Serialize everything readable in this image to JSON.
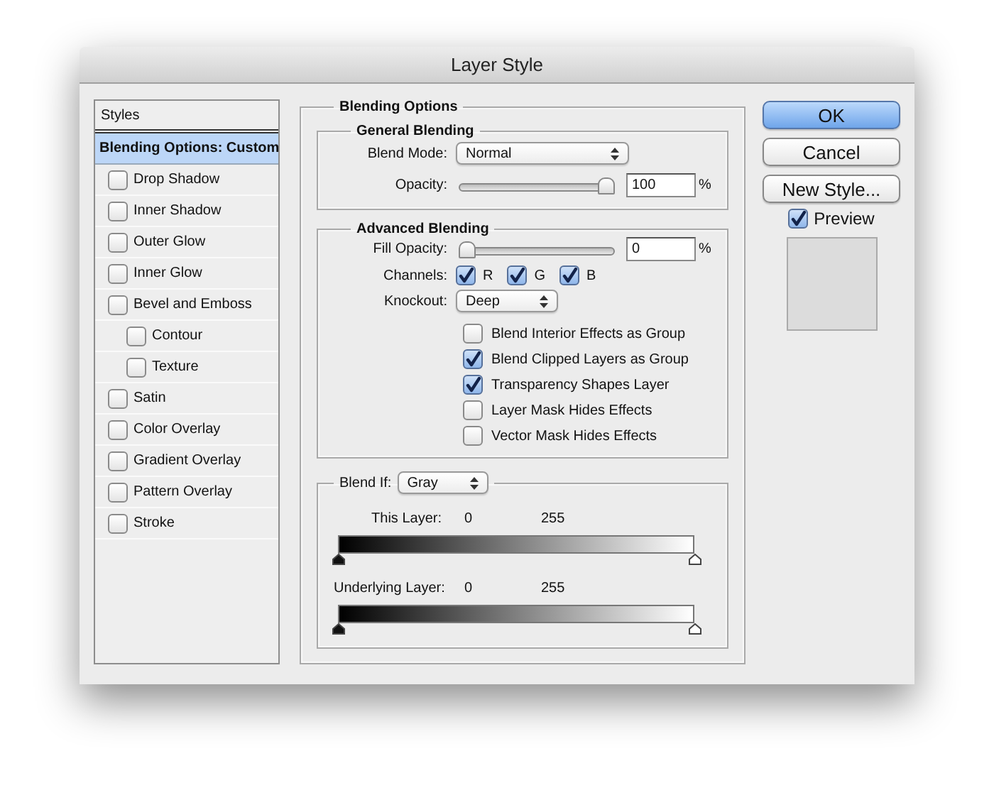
{
  "window": {
    "title": "Layer Style"
  },
  "styles": {
    "header": "Styles",
    "items": [
      {
        "kind": "plain",
        "label": "Blending Options: Custom",
        "selected": true
      },
      {
        "kind": "checkbox",
        "label": "Drop Shadow",
        "checked": false,
        "selected": false
      },
      {
        "kind": "checkbox",
        "label": "Inner Shadow",
        "checked": false,
        "selected": false
      },
      {
        "kind": "checkbox",
        "label": "Outer Glow",
        "checked": false,
        "selected": false
      },
      {
        "kind": "checkbox",
        "label": "Inner Glow",
        "checked": false,
        "selected": false
      },
      {
        "kind": "checkbox",
        "label": "Bevel and Emboss",
        "checked": false,
        "selected": false,
        "children": [
          {
            "kind": "checkbox",
            "label": "Contour",
            "checked": false,
            "selected": false
          },
          {
            "kind": "checkbox",
            "label": "Texture",
            "checked": false,
            "selected": false
          }
        ]
      },
      {
        "kind": "checkbox",
        "label": "Satin",
        "checked": false,
        "selected": false
      },
      {
        "kind": "checkbox",
        "label": "Color Overlay",
        "checked": false,
        "selected": false
      },
      {
        "kind": "checkbox",
        "label": "Gradient Overlay",
        "checked": false,
        "selected": false
      },
      {
        "kind": "checkbox",
        "label": "Pattern Overlay",
        "checked": false,
        "selected": false
      },
      {
        "kind": "checkbox",
        "label": "Stroke",
        "checked": false,
        "selected": false
      }
    ]
  },
  "blending": {
    "title": "Blending Options",
    "general": {
      "title": "General Blending",
      "blend_mode": {
        "label": "Blend Mode:",
        "value": "Normal"
      },
      "opacity": {
        "label": "Opacity:",
        "level": 1,
        "value": "100",
        "unit": "%"
      }
    },
    "advanced": {
      "title": "Advanced Blending",
      "fill_opacity": {
        "label": "Fill Opacity:",
        "level": 0,
        "value": "0",
        "unit": "%"
      },
      "channels": {
        "label": "Channels:",
        "items": [
          {
            "label": "R",
            "checked": true
          },
          {
            "label": "G",
            "checked": true
          },
          {
            "label": "B",
            "checked": true
          }
        ]
      },
      "knockout": {
        "label": "Knockout:",
        "value": "Deep"
      },
      "options": [
        {
          "label": "Blend Interior Effects as Group",
          "checked": false
        },
        {
          "label": "Blend Clipped Layers as Group",
          "checked": true
        },
        {
          "label": "Transparency Shapes Layer",
          "checked": true
        },
        {
          "label": "Layer Mask Hides Effects",
          "checked": false
        },
        {
          "label": "Vector Mask Hides Effects",
          "checked": false
        }
      ]
    },
    "blend_if": {
      "label": "Blend If:",
      "value": "Gray",
      "ramps": [
        {
          "label": "This Layer:",
          "low": "0",
          "high": "255",
          "handles": [
            {
              "level": 0
            },
            {
              "level": 1
            }
          ]
        },
        {
          "label": "Underlying Layer:",
          "low": "0",
          "high": "255",
          "handles": [
            {
              "level": 0
            },
            {
              "level": 1
            }
          ]
        }
      ]
    }
  },
  "buttons": [
    {
      "label": "OK",
      "default": true
    },
    {
      "label": "Cancel",
      "default": false
    },
    {
      "label": "New Style...",
      "default": false
    }
  ],
  "preview": {
    "label": "Preview",
    "checked": true
  }
}
